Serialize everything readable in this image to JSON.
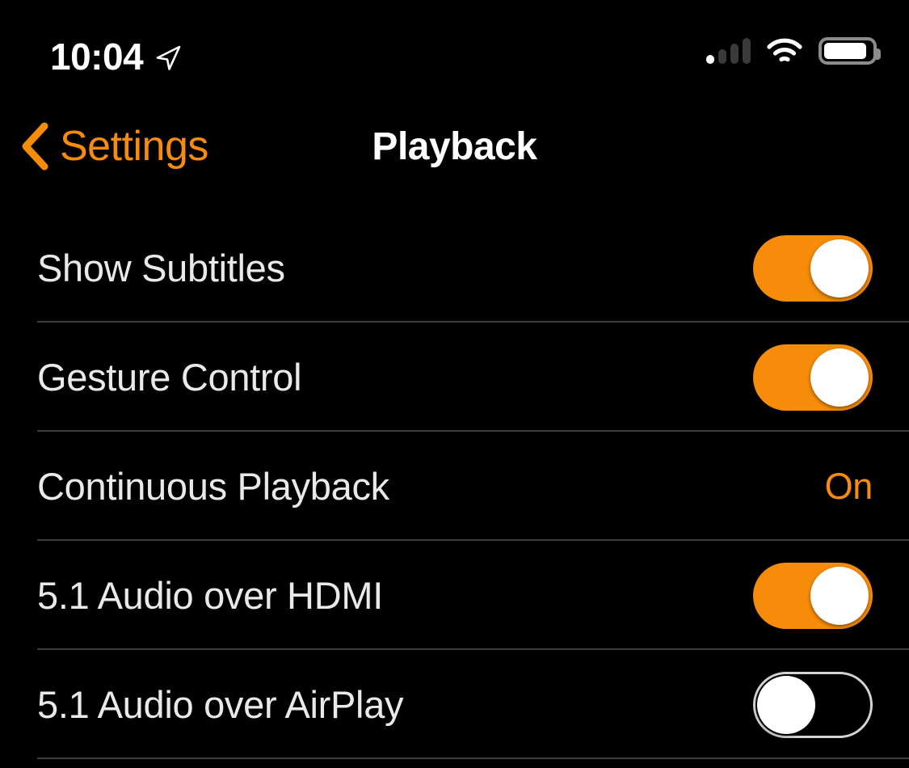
{
  "status_bar": {
    "time": "10:04",
    "location_icon": "location-arrow-icon",
    "signal": {
      "icon": "cellular-signal-icon",
      "bars_total": 4,
      "bars_active": 1
    },
    "wifi_icon": "wifi-icon",
    "battery": {
      "icon": "battery-icon",
      "level_percent": 95
    }
  },
  "nav": {
    "back_label": "Settings",
    "back_icon": "chevron-left-icon",
    "title": "Playback"
  },
  "colors": {
    "background": "#000000",
    "accent_orange": "#F78C0A",
    "row_label": "#E9E9E9",
    "separator": "#3D3D3D",
    "toggle_off_border": "#D4D4D4",
    "toggle_knob": "#FFFFFF"
  },
  "rows": [
    {
      "label": "Show Subtitles",
      "control": "toggle",
      "state": "on",
      "state_label": "On"
    },
    {
      "label": "Gesture Control",
      "control": "toggle",
      "state": "on",
      "state_label": "On"
    },
    {
      "label": "Continuous Playback",
      "control": "value",
      "value": "On"
    },
    {
      "label": "5.1 Audio over HDMI",
      "control": "toggle",
      "state": "on",
      "state_label": "On"
    },
    {
      "label": "5.1 Audio over AirPlay",
      "control": "toggle",
      "state": "off",
      "state_label": "Off"
    }
  ]
}
